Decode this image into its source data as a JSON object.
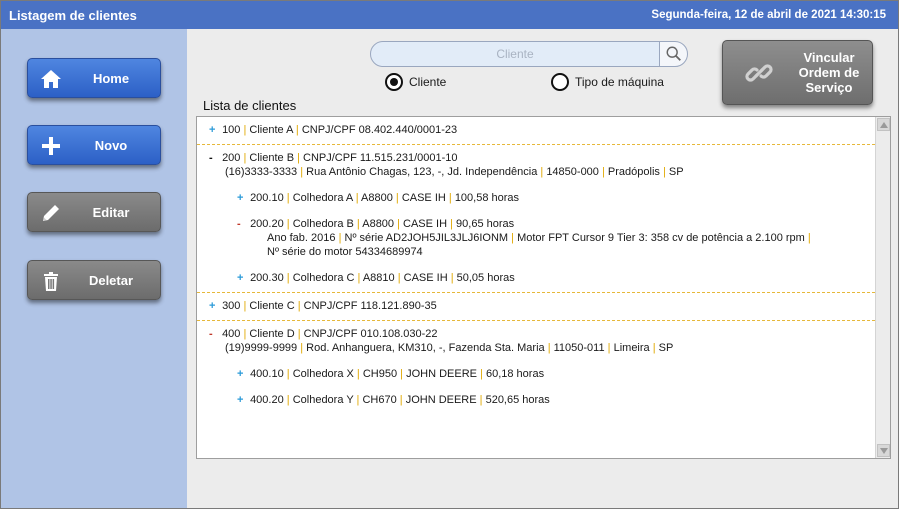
{
  "window": {
    "title": "Listagem de clientes",
    "datetime": "Segunda-feira, 12 de abril de 2021 14:30:15"
  },
  "sidebar": {
    "buttons": [
      {
        "label": "Home",
        "icon": "home-icon"
      },
      {
        "label": "Novo",
        "icon": "plus-icon"
      },
      {
        "label": "Editar",
        "icon": "pencil-icon"
      },
      {
        "label": "Deletar",
        "icon": "trash-icon"
      }
    ]
  },
  "search": {
    "placeholder": "Cliente",
    "icon": "search-icon"
  },
  "filter": {
    "options": [
      {
        "label": "Cliente",
        "selected": true
      },
      {
        "label": "Tipo de máquina",
        "selected": false
      }
    ]
  },
  "link_button": {
    "label_line1": "Vincular",
    "label_line2": "Ordem de",
    "label_line3": "Serviço",
    "icon": "link-icon"
  },
  "list": {
    "title": "Lista de clientes",
    "clients": [
      {
        "sign": "+",
        "id": "100",
        "name": "Cliente A",
        "doc": "CNPJ/CPF 08.402.440/0001-23"
      },
      {
        "sign": "-",
        "id": "200",
        "name": "Cliente B",
        "doc": "CNPJ/CPF 11.515.231/0001-10",
        "phone": "(16)3333-3333",
        "address": "Rua Antônio Chagas, 123, -, Jd. Independência",
        "cep": "14850-000",
        "city": "Pradópolis",
        "state": "SP",
        "machines": [
          {
            "sign": "+",
            "id": "200.10",
            "name": "Colhedora A",
            "model": "A8800",
            "brand": "CASE IH",
            "hours": "100,58 horas"
          },
          {
            "sign": "-",
            "id": "200.20",
            "name": "Colhedora B",
            "model": "A8800",
            "brand": "CASE IH",
            "hours": "90,65 horas",
            "year": "Ano fab. 2016",
            "serial": "Nº série AD2JOH5JIL3JLJ6IONM",
            "engine": "Motor FPT Cursor 9 Tier 3: 358 cv de potência a 2.100 rpm",
            "engine_serial": "Nº série do motor 54334689974"
          },
          {
            "sign": "+",
            "id": "200.30",
            "name": "Colhedora C",
            "model": "A8810",
            "brand": "CASE IH",
            "hours": "50,05 horas"
          }
        ]
      },
      {
        "sign": "+",
        "id": "300",
        "name": "Cliente C",
        "doc": "CNPJ/CPF 118.121.890-35"
      },
      {
        "sign": "-",
        "id": "400",
        "name": "Cliente D",
        "doc": "CNPJ/CPF 010.108.030-22",
        "phone": "(19)9999-9999",
        "address": "Rod. Anhanguera, KM310, -, Fazenda Sta. Maria",
        "cep": "11050-011",
        "city": "Limeira",
        "state": "SP",
        "machines": [
          {
            "sign": "+",
            "id": "400.10",
            "name": "Colhedora X",
            "model": "CH950",
            "brand": "JOHN DEERE",
            "hours": "60,18 horas"
          },
          {
            "sign": "+",
            "id": "400.20",
            "name": "Colhedora Y",
            "model": "CH670",
            "brand": "JOHN DEERE",
            "hours": "520,65 horas"
          }
        ]
      }
    ]
  },
  "colors": {
    "titlebar": "#4a72c4",
    "sidebar": "#b0c4e6",
    "button_blue": "#3a6fd6",
    "button_gray": "#7a7a7a",
    "separator": "#e0a800",
    "plus_sign": "#2a9ad8"
  }
}
